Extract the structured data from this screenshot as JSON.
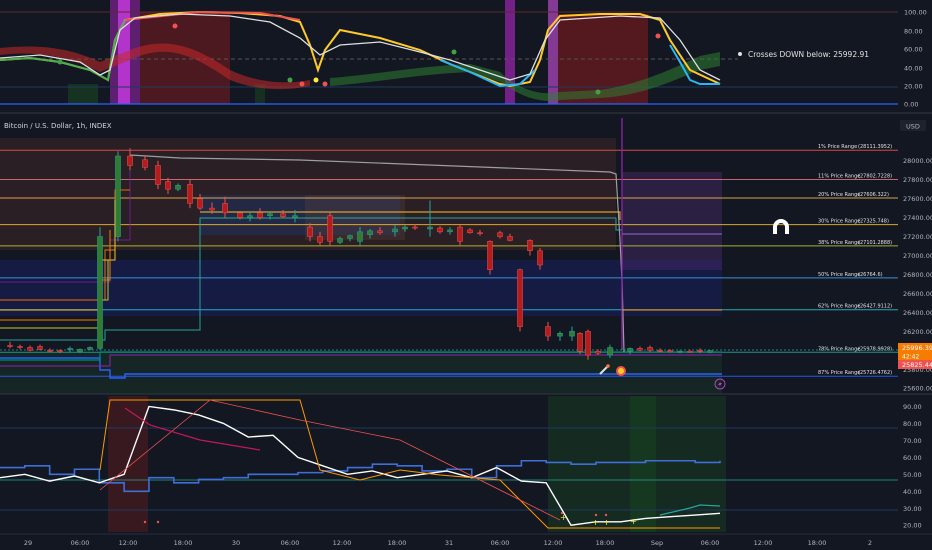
{
  "header": {
    "symbol_title": "Bitcoin / U.S. Dollar, 1h, INDEX",
    "currency": "USD"
  },
  "colors": {
    "background": "#131722",
    "up": "#26a69a",
    "down": "#ef5350",
    "accent_blue": "#2962ff",
    "orange": "#ff9800"
  },
  "top_panel": {
    "y_ticks": [
      "100.00",
      "80.00",
      "60.00",
      "40.00",
      "20.00",
      "0.00"
    ],
    "tooltip": "Crosses DOWN below: 25992.91"
  },
  "price_panel": {
    "y_ticks": [
      "28000.00",
      "27800.00",
      "27600.00",
      "27400.00",
      "27200.00",
      "27000.00",
      "26800.00",
      "26600.00",
      "26400.00",
      "26200.00",
      "26000.00",
      "25800.00",
      "25600.00"
    ],
    "last_price_label": "25996.39",
    "countdown_label": "42:42",
    "red_price_label": "25825.44",
    "fib_levels": [
      {
        "label": "1% Price Range",
        "value": "(28111.3952)"
      },
      {
        "label": "11% Price Range",
        "value": "(27802.7228)"
      },
      {
        "label": "20% Price Range",
        "value": "(27606.322)"
      },
      {
        "label": "30% Price Range",
        "value": "(27325.748)"
      },
      {
        "label": "38% Price Range",
        "value": "(27101.2888)"
      },
      {
        "label": "50% Price Range",
        "value": "(26764.6)"
      },
      {
        "label": "62% Price Range",
        "value": "(26427.9112)"
      },
      {
        "label": "78% Price Range",
        "value": "(25978.9928)"
      },
      {
        "label": "87% Price Range",
        "value": "(25726.4762)"
      }
    ]
  },
  "bottom_panel": {
    "y_ticks": [
      "90.00",
      "80.00",
      "70.00",
      "60.00",
      "50.00",
      "40.00",
      "30.00",
      "20.00"
    ]
  },
  "time_axis": [
    "29",
    "06:00",
    "12:00",
    "18:00",
    "30",
    "06:00",
    "12:00",
    "18:00",
    "31",
    "06:00",
    "12:00",
    "18:00",
    "Sep",
    "06:00",
    "12:00",
    "18:00",
    "2"
  ],
  "chart_data": [
    {
      "type": "candlestick",
      "title": "Bitcoin / U.S. Dollar, 1h, INDEX",
      "ylabel": "USD",
      "ylim": [
        25560,
        28240
      ],
      "x_ticks": [
        "29",
        "06:00",
        "12:00",
        "18:00",
        "30",
        "06:00",
        "12:00",
        "18:00",
        "31",
        "06:00",
        "12:00",
        "18:00",
        "Sep",
        "06:00",
        "12:00",
        "18:00",
        "2"
      ],
      "ohlc_sample": [
        {
          "o": 26050,
          "h": 26090,
          "l": 26020,
          "c": 26040
        },
        {
          "o": 26040,
          "h": 26060,
          "l": 26000,
          "c": 26010
        },
        {
          "o": 26010,
          "h": 26040,
          "l": 25980,
          "c": 26020
        },
        {
          "o": 26020,
          "h": 27300,
          "l": 26000,
          "c": 27200
        },
        {
          "o": 27200,
          "h": 28100,
          "l": 27150,
          "c": 28050
        },
        {
          "o": 28050,
          "h": 28130,
          "l": 27900,
          "c": 27950
        },
        {
          "o": 27950,
          "h": 28000,
          "l": 27700,
          "c": 27750
        },
        {
          "o": 27750,
          "h": 27800,
          "l": 27500,
          "c": 27550
        },
        {
          "o": 27550,
          "h": 27620,
          "l": 27400,
          "c": 27450
        },
        {
          "o": 27450,
          "h": 27500,
          "l": 27380,
          "c": 27400
        },
        {
          "o": 27400,
          "h": 27480,
          "l": 27350,
          "c": 27420
        },
        {
          "o": 27420,
          "h": 27460,
          "l": 27100,
          "c": 27150
        },
        {
          "o": 27150,
          "h": 27300,
          "l": 27100,
          "c": 27250
        },
        {
          "o": 27250,
          "h": 27320,
          "l": 27200,
          "c": 27280
        },
        {
          "o": 27280,
          "h": 27580,
          "l": 27200,
          "c": 27300
        },
        {
          "o": 27300,
          "h": 27320,
          "l": 27100,
          "c": 27150
        },
        {
          "o": 27150,
          "h": 27160,
          "l": 26800,
          "c": 26850
        },
        {
          "o": 26850,
          "h": 26860,
          "l": 26200,
          "c": 26250
        },
        {
          "o": 26250,
          "h": 26300,
          "l": 26100,
          "c": 26150
        },
        {
          "o": 26150,
          "h": 26250,
          "l": 26100,
          "c": 26200
        },
        {
          "o": 26200,
          "h": 26220,
          "l": 25900,
          "c": 25950
        },
        {
          "o": 25950,
          "h": 26060,
          "l": 25920,
          "c": 26030
        },
        {
          "o": 26030,
          "h": 26050,
          "l": 25980,
          "c": 26000
        },
        {
          "o": 26000,
          "h": 26020,
          "l": 25970,
          "c": 25996.39
        }
      ],
      "fib_values": [
        28111.3952,
        27802.7228,
        27606.322,
        27325.748,
        27101.2888,
        26764.6,
        26427.9112,
        25978.9928,
        25726.4762
      ]
    },
    {
      "type": "line",
      "title": "",
      "ylim": [
        0,
        105
      ],
      "y_ticks": [
        100,
        80,
        60,
        40,
        20,
        0
      ],
      "series": [
        {
          "name": "",
          "values": [
            50,
            55,
            48,
            30,
            95,
            100,
            100,
            100,
            99,
            98,
            96,
            94,
            20,
            92,
            90,
            70,
            45,
            42,
            40,
            50,
            100,
            100,
            100,
            98,
            30,
            25,
            22
          ]
        }
      ]
    },
    {
      "type": "line",
      "title": "",
      "ylim": [
        16,
        95
      ],
      "y_ticks": [
        90,
        80,
        70,
        60,
        50,
        40,
        30,
        20
      ],
      "series": [
        {
          "name": "",
          "values": [
            48,
            50,
            46,
            49,
            45,
            50,
            90,
            88,
            85,
            80,
            72,
            73,
            60,
            55,
            50,
            52,
            48,
            50,
            52,
            48,
            54,
            46,
            45,
            20,
            22,
            22,
            24,
            25,
            26,
            27
          ]
        },
        {
          "name": "",
          "values": [
            54,
            55,
            50,
            53,
            45,
            40,
            48,
            45,
            47,
            48,
            50,
            50,
            51,
            52,
            54,
            56,
            55,
            52,
            53,
            48,
            55,
            58,
            57,
            56,
            57,
            57,
            58,
            58,
            57,
            58
          ]
        }
      ]
    }
  ]
}
